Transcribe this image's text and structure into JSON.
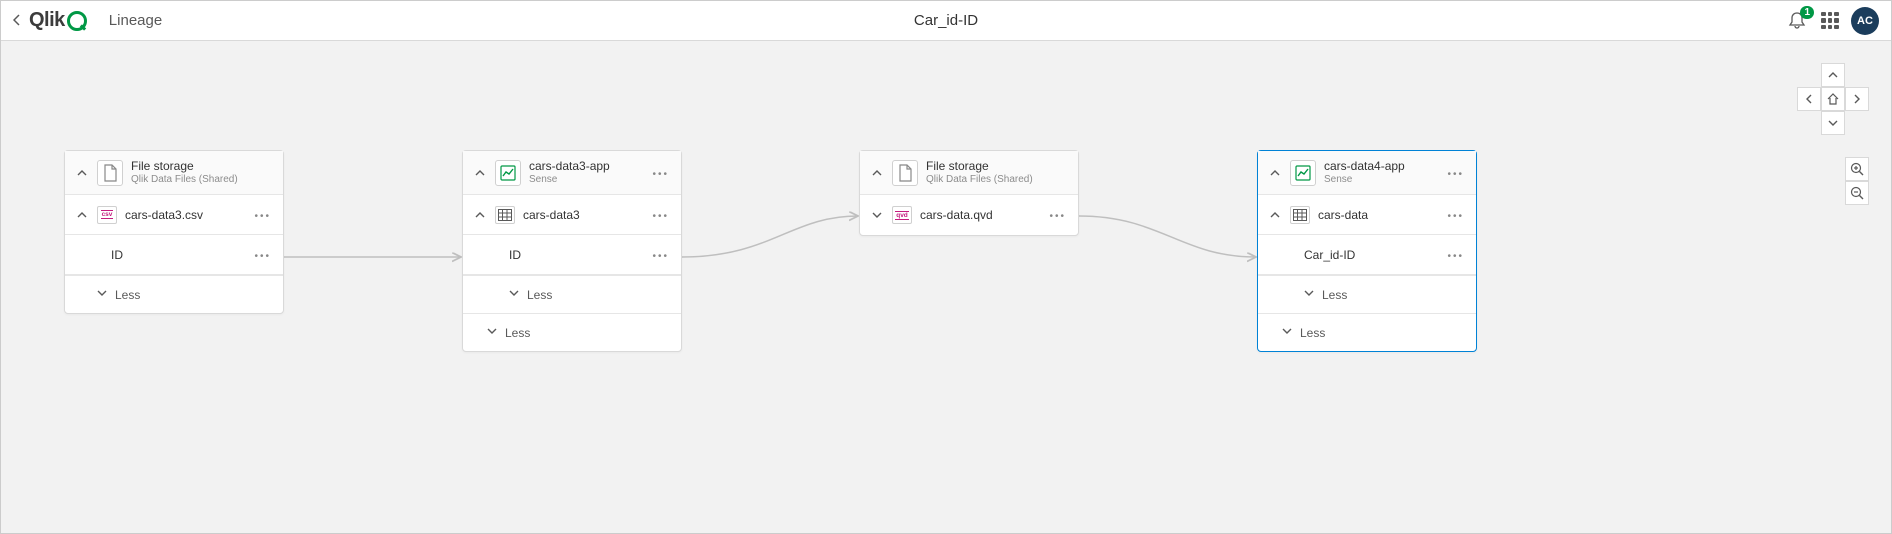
{
  "header": {
    "page_title": "Lineage",
    "center_title": "Car_id-ID",
    "notification_count": "1",
    "avatar_initials": "AC"
  },
  "nodes": {
    "n1": {
      "title": "File storage",
      "subtitle": "Qlik Data Files (Shared)",
      "child_label": "cars-data3.csv",
      "field_label": "ID",
      "less_label": "Less"
    },
    "n2": {
      "title": "cars-data3-app",
      "subtitle": "Sense",
      "child_label": "cars-data3",
      "field_label": "ID",
      "less_label_inner": "Less",
      "less_label_outer": "Less"
    },
    "n3": {
      "title": "File storage",
      "subtitle": "Qlik Data Files (Shared)",
      "child_label": "cars-data.qvd"
    },
    "n4": {
      "title": "cars-data4-app",
      "subtitle": "Sense",
      "child_label": "cars-data",
      "field_label": "Car_id-ID",
      "less_label_inner": "Less",
      "less_label_outer": "Less"
    }
  }
}
